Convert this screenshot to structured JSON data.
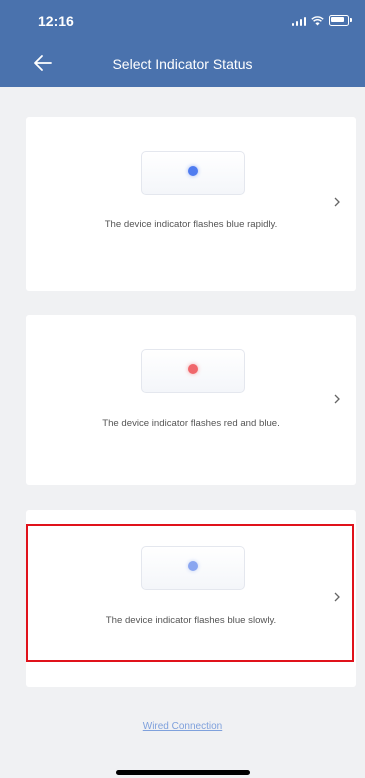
{
  "status_bar": {
    "time": "12:16"
  },
  "header": {
    "title": "Select Indicator Status"
  },
  "cards": [
    {
      "description": "The device indicator flashes blue rapidly.",
      "dot_color": "#4f7cf0"
    },
    {
      "description": "The device indicator flashes red and blue.",
      "dot_color": "#f0676b"
    },
    {
      "description": "The device indicator flashes blue slowly.",
      "dot_color": "#8aa6f0"
    }
  ],
  "footer": {
    "link_label": "Wired Connection"
  },
  "colors": {
    "header_bg": "#4a72ad",
    "highlight": "#e0121b",
    "link": "#7fa1dc"
  }
}
